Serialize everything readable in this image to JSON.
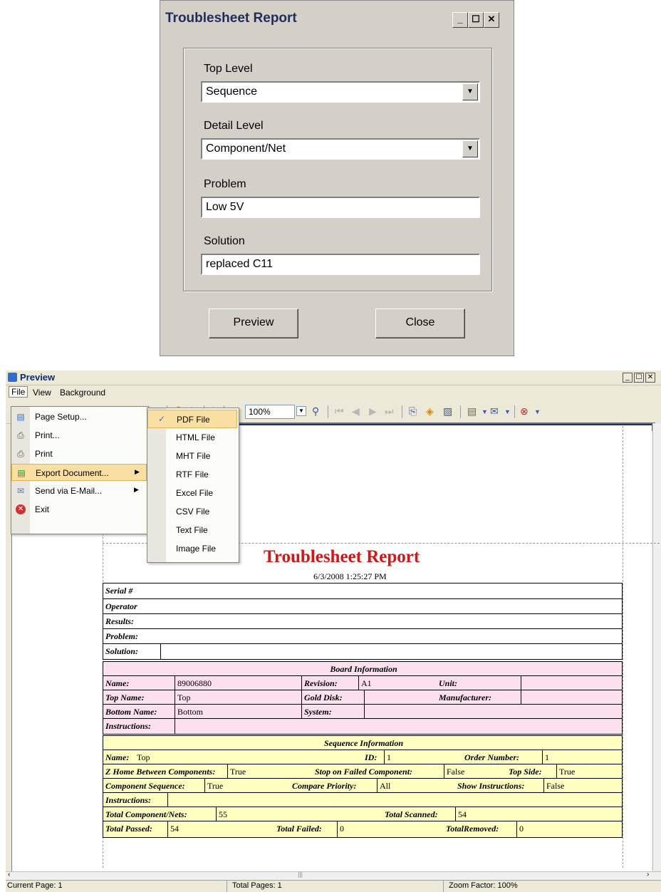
{
  "dialog": {
    "title": "Troublesheet Report",
    "top_level_label": "Top Level",
    "top_level_value": "Sequence",
    "detail_level_label": "Detail Level",
    "detail_level_value": "Component/Net",
    "problem_label": "Problem",
    "problem_value": "Low 5V",
    "solution_label": "Solution",
    "solution_value": "replaced C11",
    "preview_button": "Preview",
    "close_button": "Close"
  },
  "preview": {
    "title": "Preview",
    "menu": [
      "File",
      "View",
      "Background"
    ],
    "zoom": "100%",
    "file_menu": [
      {
        "label": "Page Setup...",
        "icon": "page-setup-icon"
      },
      {
        "label": "Print...",
        "icon": "print-dialog-icon"
      },
      {
        "label": "Print",
        "icon": "print-icon"
      },
      {
        "label": "Export Document...",
        "icon": "export-icon",
        "submenu": true
      },
      {
        "label": "Send via E-Mail...",
        "icon": "email-icon",
        "submenu": true
      },
      {
        "label": "Exit",
        "icon": "exit-icon"
      }
    ],
    "export_submenu": [
      "PDF File",
      "HTML File",
      "MHT File",
      "RTF File",
      "Excel File",
      "CSV File",
      "Text File",
      "Image File"
    ],
    "status": {
      "current_page": "Current Page: 1",
      "total_pages": "Total Pages: 1",
      "zoom_factor": "Zoom Factor: 100%"
    }
  },
  "report": {
    "title": "Troublesheet Report",
    "date": "6/3/2008 1:25:27 PM",
    "header_labels": [
      "Serial #",
      "Operator",
      "Results:",
      "Problem:",
      "Solution:"
    ],
    "board": {
      "section_title": "Board Information",
      "name_label": "Name:",
      "name_value": "89006880",
      "revision_label": "Revision:",
      "revision_value": "A1",
      "unit_label": "Unit:",
      "top_name_label": "Top Name:",
      "top_name_value": "Top",
      "gold_disk_label": "Gold Disk:",
      "manufacturer_label": "Manufacturer:",
      "bottom_name_label": "Bottom Name:",
      "bottom_name_value": "Bottom",
      "system_label": "System:",
      "instructions_label": "Instructions:"
    },
    "sequence": {
      "section_title": "Sequence Information",
      "name_label": "Name:",
      "name_value": "Top",
      "id_label": "ID:",
      "id_value": "1",
      "order_label": "Order Number:",
      "order_value": "1",
      "zhome_label": "Z Home Between Components:",
      "zhome_value": "True",
      "stop_label": "Stop on Failed Component:",
      "stop_value": "False",
      "topside_label": "Top Side:",
      "topside_value": "True",
      "compseq_label": "Component Sequence:",
      "compseq_value": "True",
      "comppri_label": "Compare Priority:",
      "comppri_value": "All",
      "showins_label": "Show Instructions:",
      "showins_value": "False",
      "instructions_label": "Instructions:",
      "totalcomp_label": "Total Component/Nets:",
      "totalcomp_value": "55",
      "totalscan_label": "Total Scanned:",
      "totalscan_value": "54",
      "passed_label": "Total Passed:",
      "passed_value": "54",
      "failed_label": "Total Failed:",
      "failed_value": "0",
      "removed_label": "TotalRemoved:",
      "removed_value": "0"
    }
  },
  "colors": {
    "board_bg": "#fde0f0",
    "sequence_bg": "#ffffc0",
    "report_title": "#d01818",
    "menu_highlight": "#fadfa2"
  }
}
